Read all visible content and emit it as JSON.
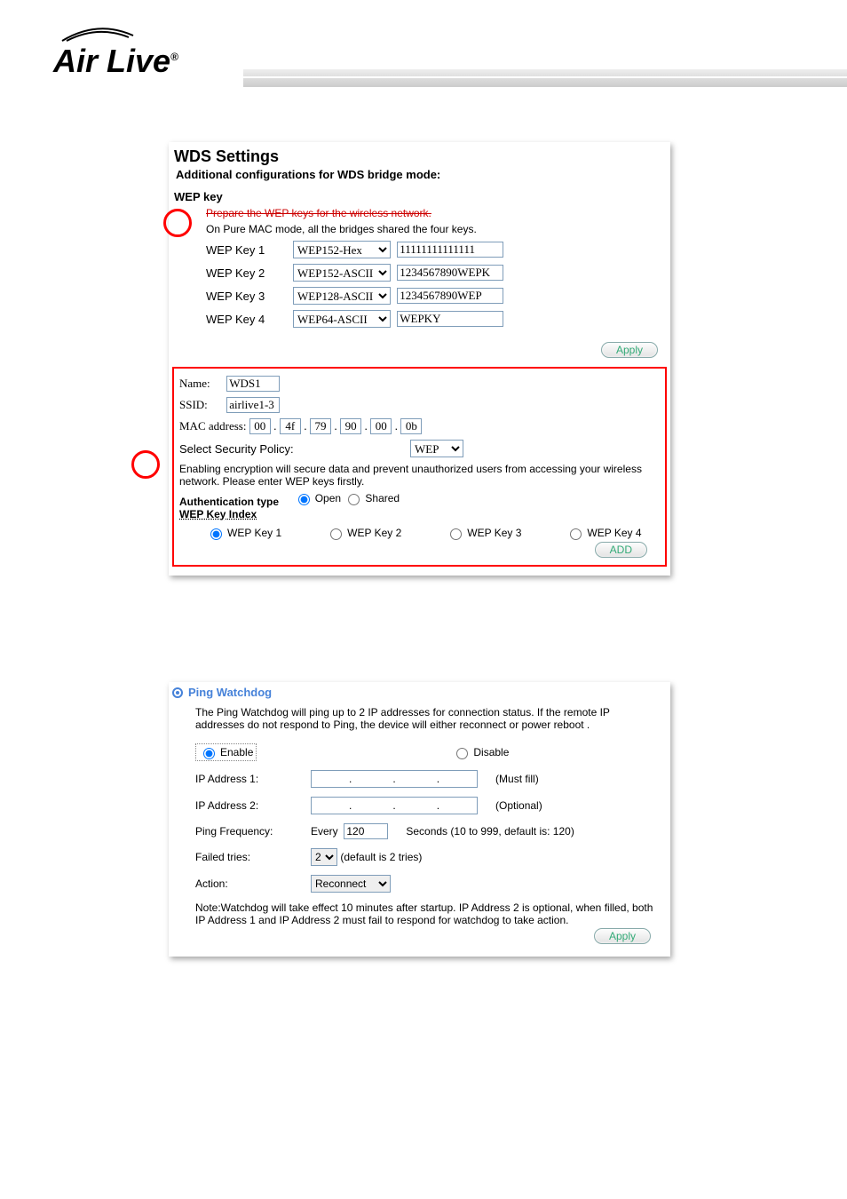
{
  "brand": "Air Live",
  "wds": {
    "title": "WDS Settings",
    "subtitle": "Additional configurations for WDS bridge mode:",
    "wep_section_label": "WEP key",
    "prepare_line": "Prepare the WEP keys for the wireless network.",
    "pure_mac_line": "On Pure MAC mode, all the bridges shared the four keys.",
    "keys": [
      {
        "label": "WEP Key 1",
        "type": "WEP152-Hex",
        "value": "11111111111111"
      },
      {
        "label": "WEP Key 2",
        "type": "WEP152-ASCII",
        "value": "1234567890WEPK"
      },
      {
        "label": "WEP Key 3",
        "type": "WEP128-ASCII",
        "value": "1234567890WEP"
      },
      {
        "label": "WEP Key 4",
        "type": "WEP64-ASCII",
        "value": "WEPKY"
      }
    ],
    "apply_label": "Apply",
    "form": {
      "name_label": "Name:",
      "name_value": "WDS1",
      "ssid_label": "SSID:",
      "ssid_value": "airlive1-3",
      "mac_label": "MAC address:",
      "mac": [
        "00",
        "4f",
        "79",
        "90",
        "00",
        "0b"
      ],
      "mac_sep": ".",
      "policy_label": "Select Security Policy:",
      "policy_value": "WEP",
      "enc_note": "Enabling encryption will secure data and prevent unauthorized users from accessing your wireless network. Please enter WEP keys firstly.",
      "auth_label": "Authentication type",
      "auth_open": "Open",
      "auth_shared": "Shared",
      "key_index_label": "WEP Key Index",
      "key_index_options": [
        "WEP Key 1",
        "WEP Key 2",
        "WEP Key 3",
        "WEP Key 4"
      ],
      "add_label": "ADD"
    }
  },
  "pw": {
    "title": "Ping Watchdog",
    "desc": "The Ping Watchdog will ping up to 2 IP addresses for connection status. If the remote IP addresses do not respond to Ping, the device will either reconnect or power reboot .",
    "enable": "Enable",
    "disable": "Disable",
    "ip1_label": "IP Address 1:",
    "ip1_hint": "(Must fill)",
    "ip2_label": "IP Address 2:",
    "ip2_hint": "(Optional)",
    "freq_label": "Ping Frequency:",
    "freq_every": "Every",
    "freq_value": "120",
    "freq_hint": "Seconds (10 to 999, default is: 120)",
    "failed_label": "Failed tries:",
    "failed_value": "2",
    "failed_hint": "(default is 2 tries)",
    "action_label": "Action:",
    "action_value": "Reconnect",
    "note": "Note:Watchdog will take effect 10 minutes after startup. IP Address 2 is optional, when filled, both IP Address 1 and IP Address 2 must fail to respond for watchdog to take action.",
    "apply_label": "Apply"
  }
}
